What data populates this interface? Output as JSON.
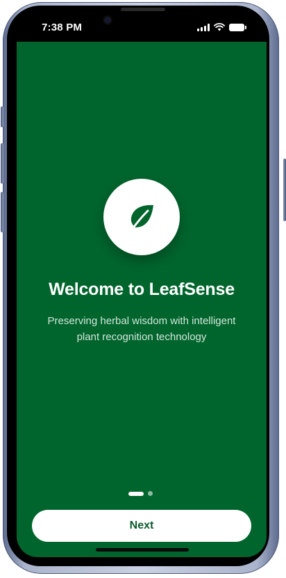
{
  "status_bar": {
    "time": "7:38 PM",
    "icons": [
      "signal-icon",
      "wifi-icon",
      "battery-icon"
    ]
  },
  "onboarding": {
    "logo_icon": "leaf-icon",
    "title": "Welcome to LeafSense",
    "subtitle": "Preserving herbal wisdom with intelligent plant recognition technology",
    "page_indicator": {
      "current": 1,
      "total": 2
    },
    "next_label": "Next"
  },
  "colors": {
    "background": "#00652d",
    "accent": "#0b5a2c",
    "button_background": "#ffffff",
    "text_primary": "#ffffff"
  }
}
